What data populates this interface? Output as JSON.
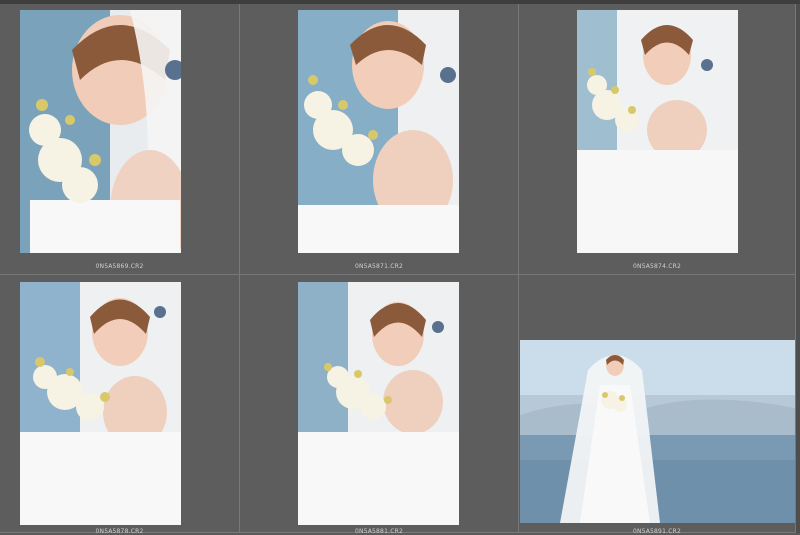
{
  "grid": {
    "thumbnails": [
      {
        "filename": "0N5A5869.CR2",
        "orientation": "portrait",
        "crop": "closeup-eyes-closed"
      },
      {
        "filename": "0N5A5871.CR2",
        "orientation": "portrait",
        "crop": "closeup-looking-down"
      },
      {
        "filename": "0N5A5874.CR2",
        "orientation": "portrait",
        "crop": "medium-looking-camera"
      },
      {
        "filename": "0N5A5878.CR2",
        "orientation": "portrait",
        "crop": "medium-bouquet"
      },
      {
        "filename": "0N5A5881.CR2",
        "orientation": "portrait",
        "crop": "medium-head-tilt"
      },
      {
        "filename": "0N5A5891.CR2",
        "orientation": "landscape",
        "crop": "full-body-seaside"
      }
    ]
  },
  "colors": {
    "background": "#5a5a5a",
    "cell_border": "#787878",
    "filename_text": "#cfcfcf",
    "sky": "#8fb3cc",
    "dress": "#f4f4f2"
  }
}
